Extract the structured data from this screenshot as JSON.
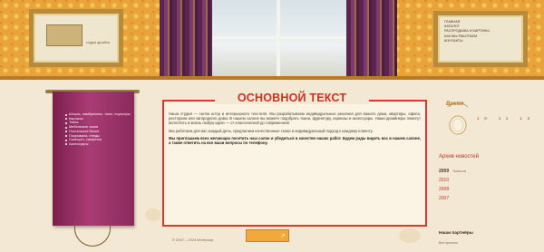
{
  "header": {
    "logo": {
      "caption": "студия дизайна"
    },
    "nav": [
      "Главная",
      "Каталог",
      "Распродажа и картины",
      "Как мы работаем",
      "Контакты"
    ]
  },
  "sidebar": {
    "items": [
      "Шторы, ламбрекены, тюль, портьеры",
      "Карнизы",
      "Ткани",
      "Мебельные ткани",
      "Постельное бельё",
      "Покрывала, пледы",
      "Скатерти, салфетки",
      "Аксессуары"
    ]
  },
  "main": {
    "title": "ОСНОВНОЙ ТЕКСТ",
    "paragraphs": [
      "Наша студия — салон штор и интерьерного текстиля. Мы разрабатываем индивидуальные решения для вашего дома, квартиры, офиса, ресторана или загородного дома. В нашем салоне вы можете подобрать ткани, фурнитуру, карнизы и аксессуары. Наши дизайнеры помогут воплотить в жизнь любую идею — от классической до современной.",
      "Мы работаем для вас каждый день, предлагаем качественные ткани и индивидуальный подход к каждому клиенту.",
      "Мы приглашаем всех желающих посетить наш салон и убедиться в качестве наших работ. Будем рады видеть вас в нашем салоне, а также ответить на все ваши вопросы по телефону."
    ]
  },
  "footer": {
    "copyright": "© 2007 – 2024 Интерьер"
  },
  "right": {
    "clock_logo_text": "Время",
    "numbers": [
      "10",
      "11",
      "12"
    ],
    "archive_title": "Архив новостей",
    "archive": [
      {
        "year": "2009",
        "sub": "Новости",
        "current": true
      },
      {
        "year": "2010",
        "sub": "",
        "current": false
      },
      {
        "year": "2008",
        "sub": "",
        "current": false
      },
      {
        "year": "2007",
        "sub": "",
        "current": false
      }
    ],
    "bottom_title": "Наши партнёры",
    "bottom_sub": "Все проекты"
  },
  "colors": {
    "accent": "#c8321f",
    "banner": "#a93c74",
    "header_bg": "#e8a43a",
    "page_bg": "#f3e8d3"
  }
}
